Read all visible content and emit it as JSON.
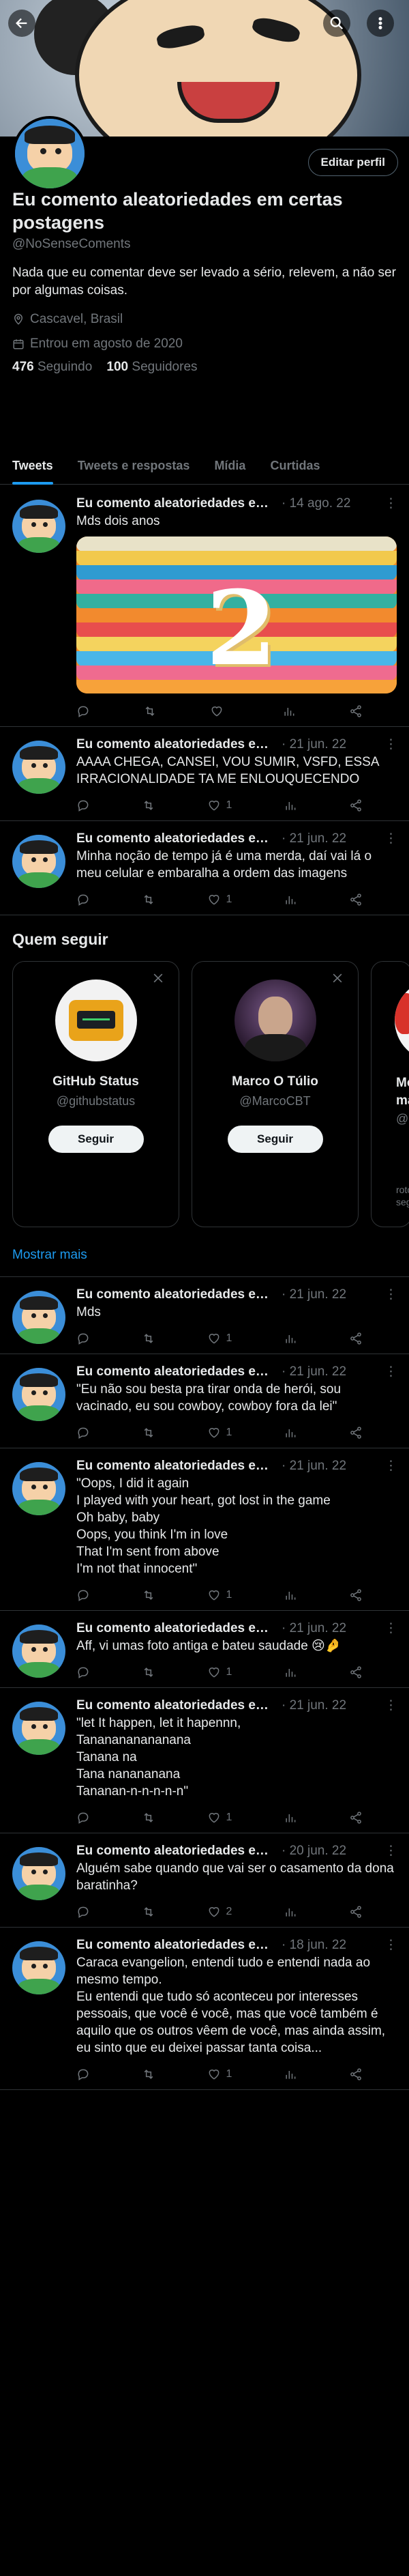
{
  "profile": {
    "name": "Eu comento aleatoriedades em certas postagens",
    "handle": "@NoSenseComents",
    "bio": "Nada que eu comentar deve ser levado a sério, relevem, a não ser por algumas coisas.",
    "location": "Cascavel, Brasil",
    "joined": "Entrou em agosto de 2020",
    "following_count": "476",
    "following_label": "Seguindo",
    "followers_count": "100",
    "followers_label": "Seguidores",
    "edit_label": "Editar perfil"
  },
  "tabs": [
    "Tweets",
    "Tweets e respostas",
    "Mídia",
    "Curtidas"
  ],
  "tweets": [
    {
      "name": "Eu comento aleatoriedades em certas postagens",
      "date": "· 14 ago. 22",
      "text": "Mds dois anos",
      "likes": "",
      "has_media": true
    },
    {
      "name": "Eu comento aleatoriedades em certas postagens",
      "date": "· 21 jun. 22",
      "text": "AAAA CHEGA, CANSEI, VOU SUMIR, VSFD, ESSA IRRACIONALIDADE TA ME ENLOUQUECENDO",
      "likes": "1"
    },
    {
      "name": "Eu comento aleatoriedades em certas postagens",
      "date": "· 21 jun. 22",
      "text": "Minha noção de tempo já é uma merda, daí vai lá o meu celular e embaralha a ordem das imagens",
      "likes": "1"
    }
  ],
  "who_to_follow": {
    "title": "Quem seguir",
    "cards": [
      {
        "name": "GitHub Status",
        "handle": "@githubstatus",
        "button": "Seguir"
      },
      {
        "name": "Marco O Túlio",
        "handle": "@MarcoCBT",
        "button": "Seguir"
      },
      {
        "name": "Mo ma",
        "handle": "@me",
        "note": "roto segu"
      }
    ],
    "show_more": "Mostrar mais"
  },
  "tweets2": [
    {
      "name": "Eu comento aleatoriedades em certas postagens",
      "date": "· 21 jun. 22",
      "text": "Mds",
      "likes": "1"
    },
    {
      "name": "Eu comento aleatoriedades em certas postagens",
      "date": "· 21 jun. 22",
      "text": "\"Eu não sou besta pra tirar onda de herói, sou vacinado, eu sou cowboy, cowboy fora da lei\"",
      "likes": "1"
    },
    {
      "name": "Eu comento aleatoriedades em certas postagens",
      "date": "· 21 jun. 22",
      "text": "\"Oops, I did it again\nI played with your heart, got lost in the game\nOh baby, baby\nOops, you think I'm in love\nThat I'm sent from above\nI'm not that innocent\"",
      "likes": "1"
    },
    {
      "name": "Eu comento aleatoriedades em certas postagens",
      "date": "· 21 jun. 22",
      "text": "Aff, vi umas foto antiga e bateu saudade 😢🤌",
      "likes": "1"
    },
    {
      "name": "Eu comento aleatoriedades em certas postagens",
      "date": "· 21 jun. 22",
      "text": "\"let It happen, let it hapennn,\nTananananananana\nTanana na\nTana nanananana\nTananan-n-n-n-n-n\"",
      "likes": "1"
    },
    {
      "name": "Eu comento aleatoriedades em certas postagens",
      "date": "· 20 jun. 22",
      "text": "Alguém sabe quando que vai ser o casamento da dona baratinha?",
      "likes": "2"
    },
    {
      "name": "Eu comento aleatoriedades em certas postagens",
      "date": "· 18 jun. 22",
      "text": "Caraca evangelion, entendi tudo e entendi nada ao mesmo tempo.\nEu entendi que tudo só aconteceu por interesses pessoais, que você é você, mas que você também é aquilo que os outros vêem de você, mas ainda assim, eu sinto que eu deixei passar tanta coisa...",
      "likes": "1"
    }
  ],
  "icons": [
    "back-arrow-icon",
    "search-icon",
    "more-vertical-icon",
    "location-icon",
    "calendar-icon",
    "reply-icon",
    "retweet-icon",
    "like-icon",
    "views-icon",
    "share-icon",
    "close-icon"
  ],
  "colors": {
    "accent": "#1d9bf0",
    "background": "#000000",
    "text": "#e7e9ea",
    "muted": "#71767b",
    "border": "#2f3336"
  }
}
